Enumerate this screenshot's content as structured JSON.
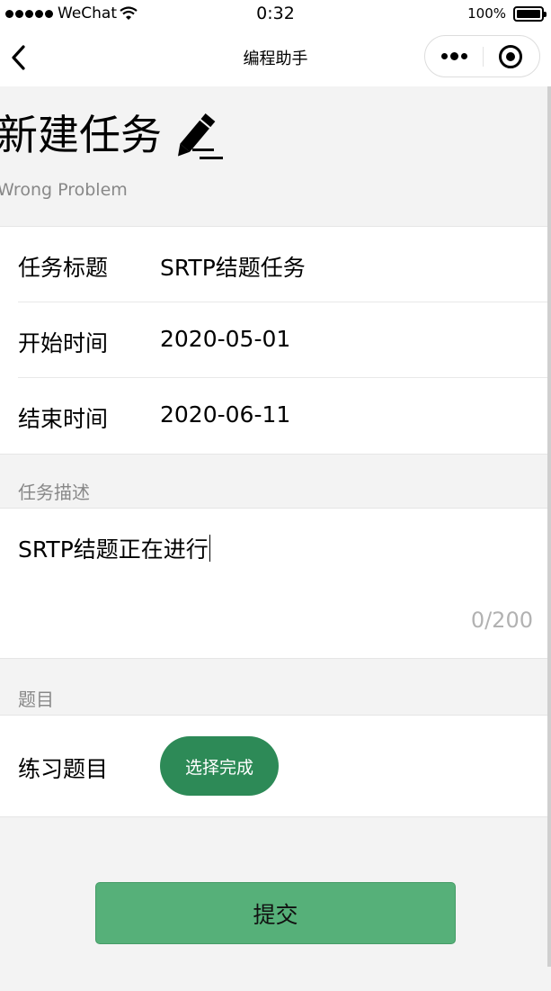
{
  "status_bar": {
    "carrier": "WeChat",
    "time": "0:32",
    "battery": "100%"
  },
  "nav": {
    "title": "编程助手"
  },
  "header": {
    "title": "新建任务",
    "subtitle": "Wrong Problem"
  },
  "task_fields": [
    {
      "label": "任务标题",
      "value": "SRTP结题任务"
    },
    {
      "label": "开始时间",
      "value": "2020-05-01"
    },
    {
      "label": "结束时间",
      "value": "2020-06-11"
    }
  ],
  "description": {
    "group_label": "任务描述",
    "value": "SRTP结题正在进行",
    "counter": "0/200"
  },
  "questions": {
    "group_label": "题目",
    "label": "练习题目",
    "button": "选择完成"
  },
  "submit": {
    "label": "提交"
  },
  "colors": {
    "select_button": "#2d8a57",
    "submit_button": "#56b079",
    "background": "#f3f3f3"
  }
}
